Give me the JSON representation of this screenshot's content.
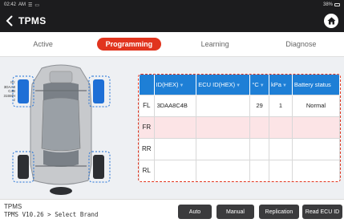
{
  "status_bar": {
    "time": "02:42",
    "ampm": "AM",
    "battery": "38%"
  },
  "header": {
    "title": "TPMS"
  },
  "tabs": [
    {
      "label": "Active"
    },
    {
      "label": "Programming"
    },
    {
      "label": "Learning"
    },
    {
      "label": "Diagnose"
    }
  ],
  "sensor_label": {
    "line1": "ID:",
    "line2": "3DAA8",
    "line3": "C4B",
    "line4": "315MH",
    "line5": "z"
  },
  "table": {
    "headers": [
      "ID(HEX)",
      "ECU ID(HEX)",
      "°C",
      "kPa",
      "Battery status"
    ],
    "rows": [
      {
        "pos": "FL",
        "id": "3DAA8C4B",
        "ecu": "",
        "temp": "29",
        "kpa": "1",
        "battery": "Normal"
      },
      {
        "pos": "FR",
        "id": "",
        "ecu": "",
        "temp": "",
        "kpa": "",
        "battery": ""
      },
      {
        "pos": "RR",
        "id": "",
        "ecu": "",
        "temp": "",
        "kpa": "",
        "battery": ""
      },
      {
        "pos": "RL",
        "id": "",
        "ecu": "",
        "temp": "",
        "kpa": "",
        "battery": ""
      }
    ]
  },
  "bottom": {
    "crumb_title": "TPMS",
    "crumb_path": "TPMS V10.26 > Select Brand",
    "buttons": {
      "auto": "Auto",
      "manual": "Manual",
      "replication": "Replication",
      "read_ecu": "Read ECU ID"
    }
  },
  "colors": {
    "accent": "#e1341e",
    "table_header": "#1e7fd6",
    "highlight_row": "#fce4e6",
    "selected_tire": "#1e6fd6"
  }
}
